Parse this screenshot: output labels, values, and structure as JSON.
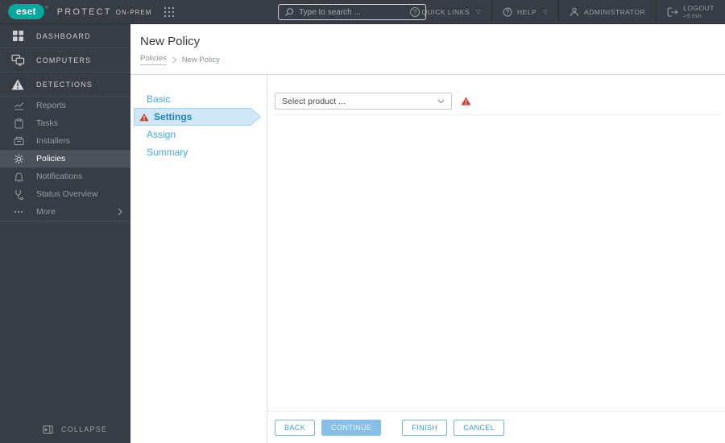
{
  "topbar": {
    "brand": {
      "logo_text": "eset",
      "reg_mark": "®",
      "product_name": "PROTECT",
      "edition": "ON-PREM"
    },
    "search_placeholder": "Type to search ...",
    "search_help": "?",
    "quick_links_label": "QUICK LINKS",
    "help_label": "HELP",
    "user_label": "ADMINISTRATOR",
    "logout_label": "LOGOUT",
    "logout_timer": ">9 min"
  },
  "sidebar": {
    "primary_items": [
      {
        "label": "DASHBOARD"
      },
      {
        "label": "COMPUTERS"
      },
      {
        "label": "DETECTIONS"
      }
    ],
    "secondary_items": [
      {
        "label": "Reports"
      },
      {
        "label": "Tasks"
      },
      {
        "label": "Installers"
      },
      {
        "label": "Policies",
        "selected": true
      },
      {
        "label": "Notifications"
      },
      {
        "label": "Status Overview"
      },
      {
        "label": "More",
        "has_submenu": true
      }
    ],
    "collapse_label": "COLLAPSE"
  },
  "page": {
    "title": "New Policy",
    "breadcrumb": {
      "parent": "Policies",
      "current": "New Policy"
    }
  },
  "wizard": {
    "steps": [
      {
        "label": "Basic"
      },
      {
        "label": "Settings",
        "active": true,
        "has_warning": true
      },
      {
        "label": "Assign"
      },
      {
        "label": "Summary"
      }
    ]
  },
  "form": {
    "product_select_value": "Select product ...",
    "has_validation_warning": true
  },
  "footer_buttons": {
    "back": "BACK",
    "continue": "CONTINUE",
    "finish": "FINISH",
    "cancel": "CANCEL"
  },
  "colors": {
    "brand_teal": "#00a79d",
    "topbar_bg": "#383d45",
    "selected_item_bg": "#4b525c",
    "accent_blue": "#3f9ad6",
    "active_step_bg": "#cfe8f8",
    "active_step_border": "#a2d2ef",
    "warning_red": "#d53a32"
  }
}
